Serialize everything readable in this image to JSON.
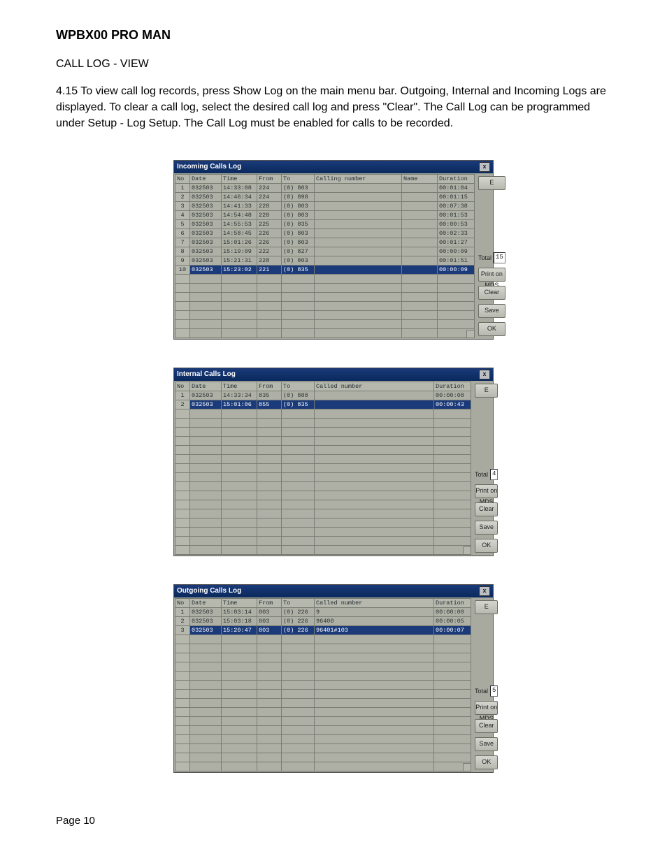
{
  "doc": {
    "title": "WPBX00 PRO MAN",
    "section": "CALL LOG - VIEW",
    "body": "4.15    To view call log records, press Show Log on the main menu bar.  Outgoing, Internal and Incoming Logs are displayed.  To clear a call log, select the desired call log and press \"Clear\". The Call Log can be programmed under Setup - Log Setup. The Call Log must be enabled for calls to be recorded.",
    "page": "Page 10"
  },
  "columns_incoming": [
    "No",
    "Date",
    "Time",
    "From",
    "To",
    "Calling number",
    "Name",
    "Duration"
  ],
  "columns_std": [
    "No",
    "Date",
    "Time",
    "From",
    "To",
    "Called number",
    "Duration"
  ],
  "close_glyph": "x",
  "incoming": {
    "title": "Incoming Calls Log",
    "rows": [
      {
        "no": "1",
        "date": "032503",
        "time": "14:33:08",
        "from": "224",
        "to": "(0) 803",
        "num": "",
        "name": "",
        "dur": "00:01:04"
      },
      {
        "no": "2",
        "date": "032503",
        "time": "14:46:34",
        "from": "224",
        "to": "(0) 898",
        "num": "",
        "name": "",
        "dur": "00:01:15"
      },
      {
        "no": "3",
        "date": "032503",
        "time": "14:41:33",
        "from": "228",
        "to": "(0) 803",
        "num": "",
        "name": "",
        "dur": "00:07:38"
      },
      {
        "no": "4",
        "date": "032503",
        "time": "14:54:48",
        "from": "228",
        "to": "(0) 803",
        "num": "",
        "name": "",
        "dur": "00:01:53"
      },
      {
        "no": "5",
        "date": "032503",
        "time": "14:55:53",
        "from": "225",
        "to": "(0) 835",
        "num": "",
        "name": "",
        "dur": "00:00:53"
      },
      {
        "no": "6",
        "date": "032503",
        "time": "14:58:45",
        "from": "226",
        "to": "(0) 803",
        "num": "",
        "name": "",
        "dur": "00:02:33"
      },
      {
        "no": "7",
        "date": "032503",
        "time": "15:01:26",
        "from": "226",
        "to": "(0) 803",
        "num": "",
        "name": "",
        "dur": "00:01:27"
      },
      {
        "no": "8",
        "date": "032503",
        "time": "15:19:09",
        "from": "222",
        "to": "(0) 827",
        "num": "",
        "name": "",
        "dur": "00:00:09"
      },
      {
        "no": "9",
        "date": "032503",
        "time": "15:21:31",
        "from": "228",
        "to": "(0) 803",
        "num": "",
        "name": "",
        "dur": "00:01:51"
      },
      {
        "no": "10",
        "date": "032503",
        "time": "15:23:02",
        "from": "221",
        "to": "(0) 835",
        "num": "",
        "name": "",
        "dur": "00:00:09"
      }
    ],
    "selected": 9,
    "side": {
      "e": "E",
      "tot_label": "Total",
      "tot": "15",
      "print": "Print on MDS",
      "clear": "Clear",
      "save": "Save",
      "ok": "OK"
    }
  },
  "internal": {
    "title": "Internal Calls Log",
    "rows": [
      {
        "no": "1",
        "date": "032503",
        "time": "14:33:34",
        "from": "835",
        "to": "(0) 888",
        "num": "",
        "dur": "00:00:08"
      },
      {
        "no": "2",
        "date": "032503",
        "time": "15:01:06",
        "from": "855",
        "to": "(0) 835",
        "num": "",
        "dur": "00:00:43"
      }
    ],
    "selected": 1,
    "empty_rows": 16,
    "side": {
      "e": "E",
      "tot_label": "Total",
      "tot": "4",
      "print": "Print on MDS",
      "clear": "Clear",
      "save": "Save",
      "ok": "OK"
    }
  },
  "outgoing": {
    "title": "Outgoing Calls Log",
    "rows": [
      {
        "no": "1",
        "date": "032503",
        "time": "15:03:14",
        "from": "803",
        "to": "(0) 226",
        "num": "9",
        "dur": "00:00:00"
      },
      {
        "no": "2",
        "date": "032503",
        "time": "15:03:18",
        "from": "803",
        "to": "(0) 226",
        "num": "96400",
        "dur": "00:00:05"
      },
      {
        "no": "3",
        "date": "032503",
        "time": "15:20:47",
        "from": "803",
        "to": "(0) 226",
        "num": "96401#103",
        "dur": "00:00:07"
      }
    ],
    "selected": 2,
    "empty_rows": 15,
    "side": {
      "e": "E",
      "tot_label": "Total",
      "tot": "5",
      "print": "Print on MDS",
      "clear": "Clear",
      "save": "Save",
      "ok": "OK"
    }
  }
}
